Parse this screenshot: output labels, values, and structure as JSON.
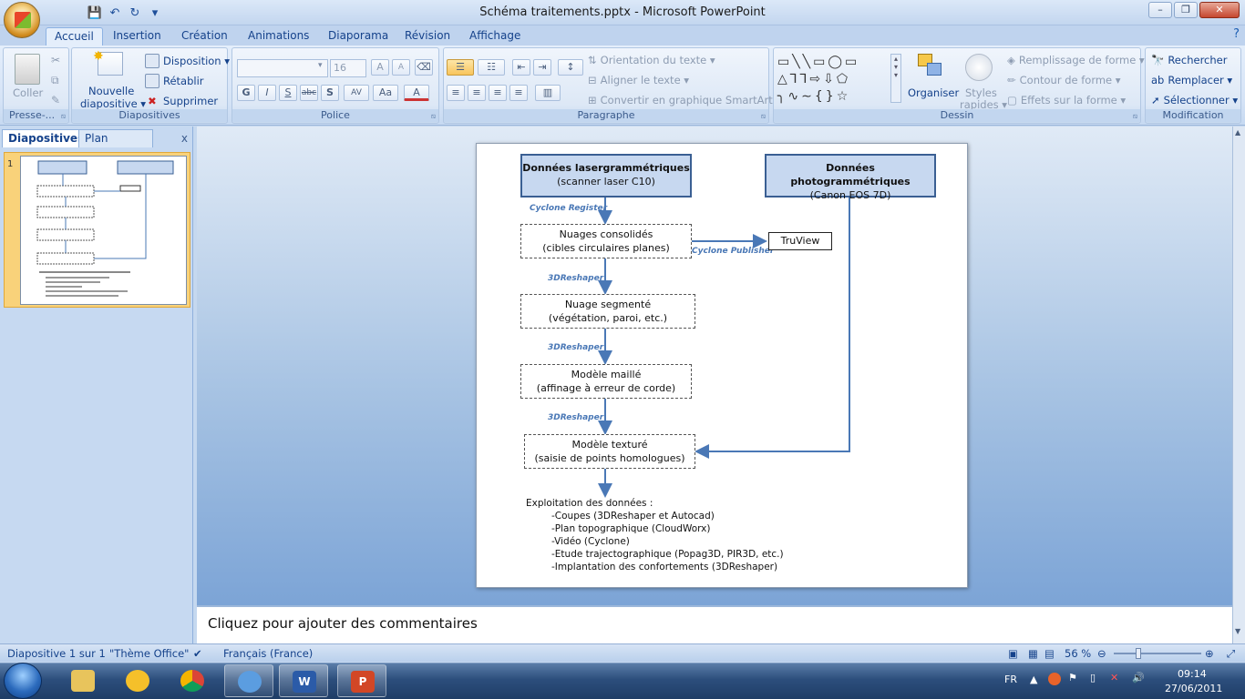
{
  "window": {
    "title": "Schéma traitements.pptx - Microsoft PowerPoint",
    "minimize": "–",
    "maximize": "❐",
    "close": "✕"
  },
  "qat": {
    "save": "💾",
    "undo": "↶",
    "redo": "↻",
    "more": "▾"
  },
  "tabs": [
    "Accueil",
    "Insertion",
    "Création",
    "Animations",
    "Diaporama",
    "Révision",
    "Affichage"
  ],
  "help": "?",
  "ribbon": {
    "presse": {
      "title": "Presse-...",
      "coller": "Coller"
    },
    "diapositives": {
      "title": "Diapositives",
      "nouvelle_line1": "Nouvelle",
      "nouvelle_line2": "diapositive ▾",
      "disposition": "Disposition ▾",
      "retablir": "Rétablir",
      "supprimer": "Supprimer"
    },
    "police": {
      "title": "Police",
      "font_name": "",
      "font_size": "16",
      "bold": "G",
      "italic": "I",
      "underline": "S",
      "strike": "abc",
      "shadow": "S",
      "spacing": "AV",
      "case": "Aa",
      "color": "A",
      "grow": "A",
      "shrink": "A"
    },
    "paragraphe": {
      "title": "Paragraphe",
      "orientation": "Orientation du texte ▾",
      "aligner": "Aligner le texte ▾",
      "smartart": "Convertir en graphique SmartArt ▾"
    },
    "dessin": {
      "title": "Dessin",
      "organiser": "Organiser",
      "styles_line1": "Styles",
      "styles_line2": "rapides ▾",
      "remplissage": "Remplissage de forme ▾",
      "contour": "Contour de forme ▾",
      "effets": "Effets sur la forme ▾"
    },
    "modification": {
      "title": "Modification",
      "rechercher": "Rechercher",
      "remplacer": "Remplacer ▾",
      "selectionner": "Sélectionner ▾"
    }
  },
  "leftpane": {
    "tab_diapositives": "Diapositives",
    "tab_plan": "Plan",
    "close": "x",
    "thumb_number": "1"
  },
  "slide": {
    "box_laser_title": "Données lasergrammétriques",
    "box_laser_sub": "(scanner laser C10)",
    "box_photo_title": "Données photogrammétriques",
    "box_photo_sub": "(Canon EOS 7D)",
    "label_register": "Cyclone Register",
    "box_nuages_1": "Nuages consolidés",
    "box_nuages_2": "(cibles circulaires planes)",
    "label_publisher": "Cyclone Publisher",
    "box_truview": "TruView",
    "label_3dr_1": "3DReshaper",
    "box_seg_1": "Nuage segmenté",
    "box_seg_2": "(végétation, paroi, etc.)",
    "label_3dr_2": "3DReshaper",
    "box_maille_1": "Modèle maillé",
    "box_maille_2": "(affinage à erreur de corde)",
    "label_3dr_3": "3DReshaper",
    "box_texture_1": "Modèle texturé",
    "box_texture_2": "(saisie de points homologues)",
    "exploitation_title": "Exploitation des données  :",
    "exploitation_items": [
      "-Coupes (3DReshaper et Autocad)",
      "-Plan topographique (CloudWorx)",
      "-Vidéo (Cyclone)",
      "-Etude trajectographique (Popag3D, PIR3D, etc.)",
      "-Implantation des confortements (3DReshaper)"
    ]
  },
  "notes": {
    "placeholder": "Cliquez pour ajouter des commentaires"
  },
  "status": {
    "slide": "Diapositive 1 sur 1",
    "theme": "\"Thème Office\"",
    "language": "Français (France)",
    "zoom": "56 %",
    "zoom_level": 0.56
  },
  "tray": {
    "lang": "FR",
    "time": "09:14",
    "date": "27/06/2011"
  },
  "colors": {
    "accent": "#15428b",
    "box_fill": "#c7d8f0",
    "box_border": "#3a5f93",
    "arrow": "#4a78b6"
  }
}
